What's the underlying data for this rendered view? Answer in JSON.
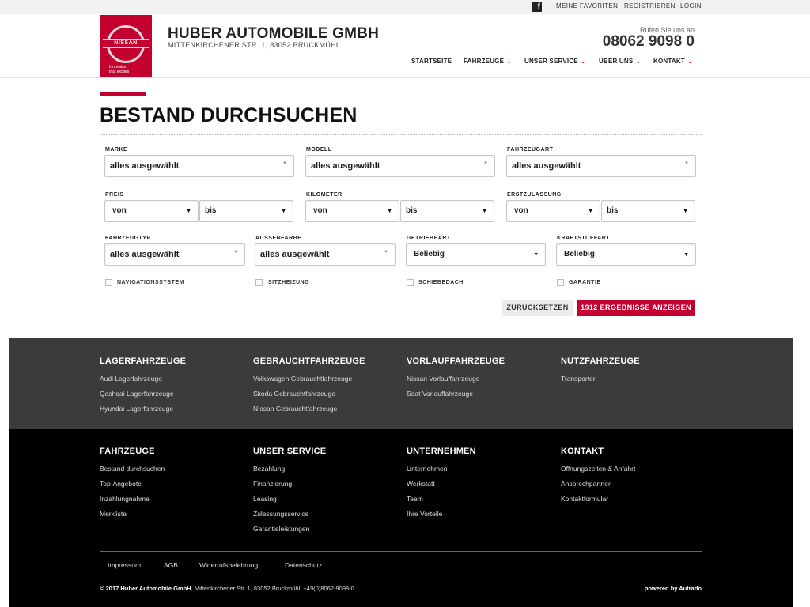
{
  "topbar": {
    "facebook_glyph": "f",
    "favorites": "MEINE FAVORITEN",
    "register": "REGISTRIEREN",
    "login": "LOGIN"
  },
  "header": {
    "logo_text": "NISSAN",
    "logo_tagline_1": "Innovation",
    "logo_tagline_2": "that excites",
    "company": "HUBER AUTOMOBILE GMBH",
    "address": "MITTENKIRCHENER STR. 1, 83052 BRUCKMÜHL",
    "call_hint": "Rufen Sie uns an",
    "phone": "08062 9098 0"
  },
  "nav": [
    {
      "label": "STARTSEITE",
      "dropdown": false
    },
    {
      "label": "FAHRZEUGE",
      "dropdown": true
    },
    {
      "label": "UNSER SERVICE",
      "dropdown": true
    },
    {
      "label": "ÜBER UNS",
      "dropdown": true
    },
    {
      "label": "KONTAKT",
      "dropdown": true
    }
  ],
  "page": {
    "title": "BESTAND DURCHSUCHEN"
  },
  "form": {
    "row1": {
      "marke_label": "MARKE",
      "marke_value": "alles ausgewählt",
      "modell_label": "MODELL",
      "modell_value": "alles ausgewählt",
      "fahrzeugart_label": "FAHRZEUGART",
      "fahrzeugart_value": "alles ausgewählt"
    },
    "row2": {
      "preis_label": "PREIS",
      "kilometer_label": "KILOMETER",
      "erstzulassung_label": "ERSTZULASSUNG",
      "von": "von",
      "bis": "bis"
    },
    "row3": {
      "fahrzeugtyp_label": "FAHRZEUGTYP",
      "fahrzeugtyp_value": "alles ausgewählt",
      "aussenfarbe_label": "AUSSENFARBE",
      "aussenfarbe_value": "alles ausgewählt",
      "getriebeart_label": "GETRIEBEART",
      "getriebeart_value": "Beliebig",
      "kraftstoffart_label": "KRAFTSTOFFART",
      "kraftstoffart_value": "Beliebig"
    },
    "checkboxes": {
      "navigation": "NAVIGATIONSSYSTEM",
      "sitzheizung": "SITZHEIZUNG",
      "schiebedach": "SCHIEBEDACH",
      "garantie": "GARANTIE"
    },
    "reset_label": "ZURÜCKSETZEN",
    "results_label": "1912  ERGEBNISSE ANZEIGEN"
  },
  "footer_top": {
    "col1": {
      "heading": "LAGERFAHRZEUGE",
      "links": [
        "Audi Lagerfahrzeuge",
        "Qashqai Lagerfahrzeuge",
        "Hyundai Lagerfahrzeuge"
      ]
    },
    "col2": {
      "heading": "GEBRAUCHTFAHRZEUGE",
      "links": [
        "Volkswagen Gebrauchtfahrzeuge",
        "Skoda Gebrauchtfahrzeuge",
        "NIssan Gebrauchtfahrzeuge"
      ]
    },
    "col3": {
      "heading": "VORLAUFFAHRZEUGE",
      "links": [
        "Nissan Vorlauffahrzeuge",
        "Seat Vorlauffahrzeuge"
      ]
    },
    "col4": {
      "heading": "NUTZFAHRZEUGE",
      "links": [
        "Transporter"
      ]
    }
  },
  "footer_bottom": {
    "col1": {
      "heading": "FAHRZEUGE",
      "links": [
        "Bestand durchsuchen",
        "Top-Angebote",
        "Inzahlungnahme",
        "Merkliste"
      ]
    },
    "col2": {
      "heading": "UNSER SERVICE",
      "links": [
        "Bezahlung",
        "Finanzierung",
        "Leasing",
        "Zulassungsservice",
        "Garantieleistungen"
      ]
    },
    "col3": {
      "heading": "UNTERNEHMEN",
      "links": [
        "Unternehmen",
        "Werkstatt",
        "Team",
        "Ihre Vorteile"
      ]
    },
    "col4": {
      "heading": "KONTAKT",
      "links": [
        "Öffnungszeiten & Anfahrt",
        "Ansprechpartner",
        "Kontaktformular"
      ]
    }
  },
  "legal": {
    "impressum": "Impressum",
    "agb": "AGB",
    "widerruf": "Widerrufsbelehrung",
    "datenschutz": "Datenschutz",
    "copyright_bold": "© 2017 Huber Automobile GmbH",
    "copyright_rest": ", Mittenkirchener Str. 1, 83052 Bruckmühl, +49(0)8062-9098-0",
    "powered": "powered by Autrado"
  }
}
